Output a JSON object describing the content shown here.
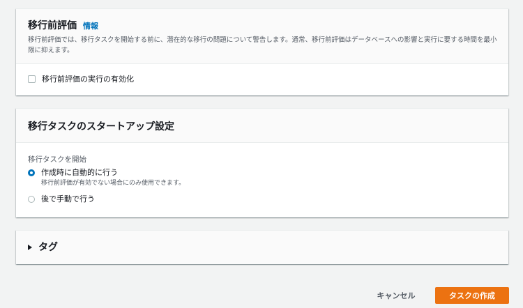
{
  "assessment": {
    "title": "移行前評価",
    "info_link": "情報",
    "description": "移行前評価では、移行タスクを開始する前に、潜在的な移行の問題について警告します。通常、移行前評価はデータベースへの影響と実行に要する時間を最小限に抑えます。",
    "checkbox_label": "移行前評価の実行の有効化",
    "checkbox_checked": false
  },
  "startup": {
    "title": "移行タスクのスタートアップ設定",
    "section_label": "移行タスクを開始",
    "options": [
      {
        "label": "作成時に自動的に行う",
        "sublabel": "移行前評価が有効でない場合にのみ使用できます。",
        "selected": true
      },
      {
        "label": "後で手動で行う",
        "selected": false
      }
    ]
  },
  "tags": {
    "title": "タグ",
    "expanded": false
  },
  "footer": {
    "cancel_label": "キャンセル",
    "create_label": "タスクの作成"
  },
  "colors": {
    "accent": "#0073bb",
    "primary_button": "#ec7211",
    "page_background": "#f2f3f3"
  }
}
